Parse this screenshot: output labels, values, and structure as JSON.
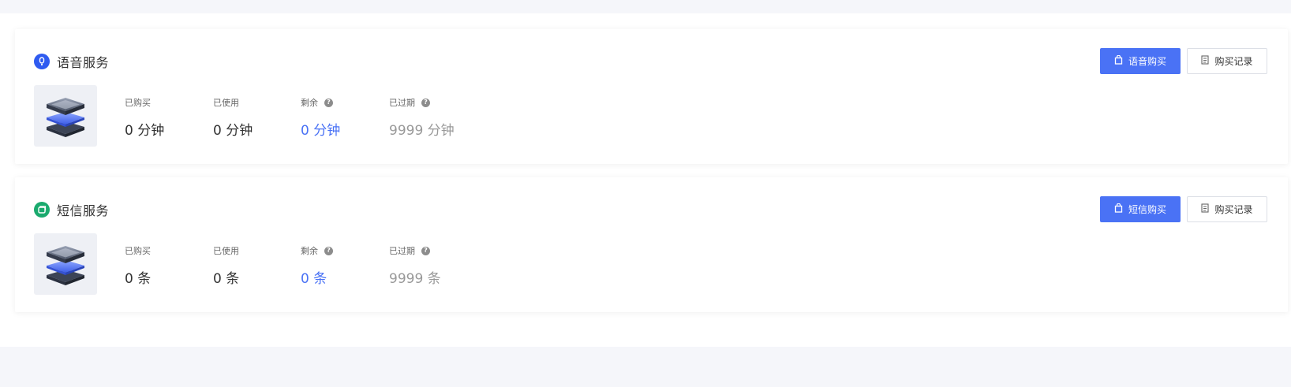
{
  "voice": {
    "title": "语音服务",
    "buy_label": "语音购买",
    "records_label": "购买记录",
    "purchased_label": "已购买",
    "purchased_value": "0 分钟",
    "used_label": "已使用",
    "used_value": "0 分钟",
    "remaining_label": "剩余",
    "remaining_value": "0 分钟",
    "expired_label": "已过期",
    "expired_value": "9999 分钟",
    "icon": "microphone-icon"
  },
  "sms": {
    "title": "短信服务",
    "buy_label": "短信购买",
    "records_label": "购买记录",
    "purchased_label": "已购买",
    "purchased_value": "0 条",
    "used_label": "已使用",
    "used_value": "0 条",
    "remaining_label": "剩余",
    "remaining_value": "0 条",
    "expired_label": "已过期",
    "expired_value": "9999 条",
    "icon": "message-icon"
  },
  "help_glyph": "?",
  "colors": {
    "primary": "#4a72f5",
    "voice_icon": "#2f5bf0",
    "sms_icon": "#1aaa6e",
    "remaining": "#4a72f5",
    "expired": "#999999"
  }
}
